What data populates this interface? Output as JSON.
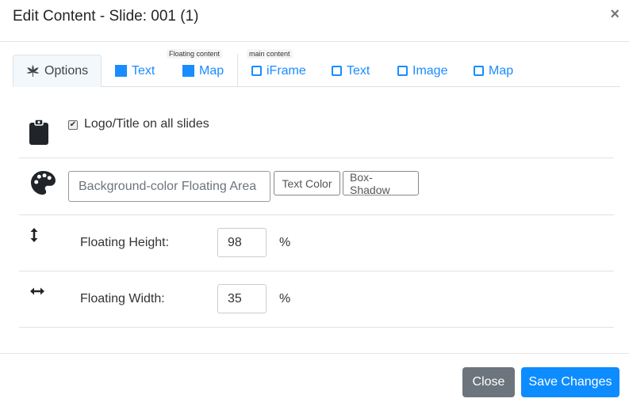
{
  "modal": {
    "title": "Edit Content - Slide: 001 (1)",
    "close_glyph": "×"
  },
  "tabs": {
    "floating_group_label": "Floating content",
    "main_group_label": "main content",
    "items": [
      {
        "label": "Options",
        "icon": "leaf-icon",
        "active": true
      },
      {
        "label": "Text",
        "icon": "filled-square",
        "checked": true
      },
      {
        "label": "Map",
        "icon": "filled-square",
        "checked": true
      },
      {
        "label": "iFrame",
        "icon": "empty-square",
        "checked": false
      },
      {
        "label": "Text",
        "icon": "empty-square",
        "checked": false
      },
      {
        "label": "Image",
        "icon": "empty-square",
        "checked": false
      },
      {
        "label": "Map",
        "icon": "empty-square",
        "checked": false
      }
    ]
  },
  "options": {
    "logo_checkbox": {
      "label": "Logo/Title on all slides",
      "checked": true,
      "icon": "clipboard-icon"
    },
    "colors": {
      "icon": "palette-icon",
      "background_input_placeholder": "Background-color Floating Area",
      "text_color_label": "Text Color",
      "box_shadow_label": "Box-Shadow"
    },
    "height": {
      "icon": "vertical-arrows-icon",
      "label": "Floating Height:",
      "value": "98",
      "unit": "%"
    },
    "width": {
      "icon": "horizontal-arrows-icon",
      "label": "Floating Width:",
      "value": "35",
      "unit": "%"
    }
  },
  "footer": {
    "close_label": "Close",
    "save_label": "Save Changes"
  },
  "colors": {
    "accent": "#1a8cff",
    "close_button": "#6c757d",
    "save_button": "#0d8cff"
  }
}
